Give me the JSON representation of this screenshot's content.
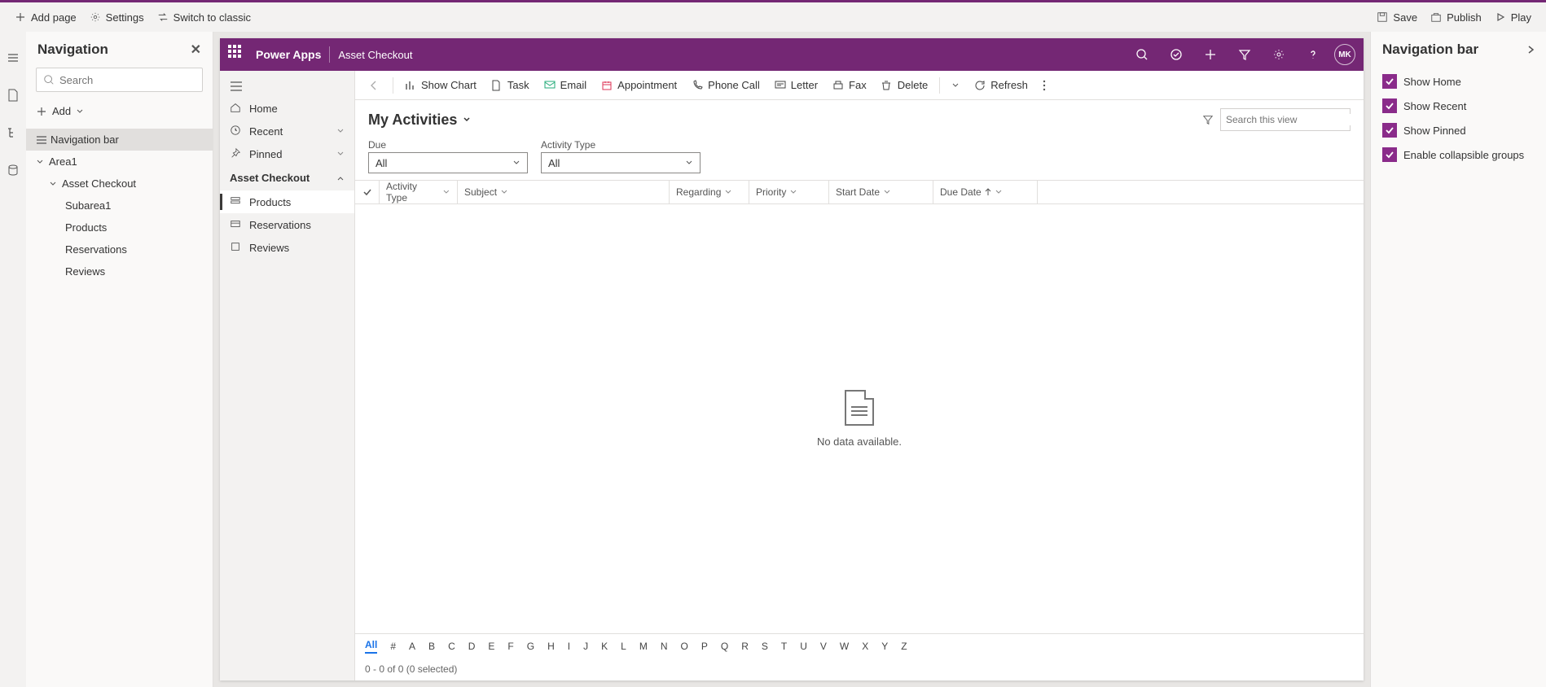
{
  "topbar": {
    "addPage": "Add page",
    "settings": "Settings",
    "switchClassic": "Switch to classic",
    "save": "Save",
    "publish": "Publish",
    "play": "Play"
  },
  "navPanel": {
    "title": "Navigation",
    "searchPlaceholder": "Search",
    "add": "Add",
    "items": {
      "navbar": "Navigation bar",
      "area1": "Area1",
      "assetCheckout": "Asset Checkout",
      "subarea1": "Subarea1",
      "products": "Products",
      "reservations": "Reservations",
      "reviews": "Reviews"
    }
  },
  "purpleBar": {
    "appName": "Power Apps",
    "areaLabel": "Asset Checkout",
    "avatar": "MK"
  },
  "siteNav": {
    "home": "Home",
    "recent": "Recent",
    "pinned": "Pinned",
    "group": "Asset Checkout",
    "products": "Products",
    "reservations": "Reservations",
    "reviews": "Reviews"
  },
  "cmdbar": {
    "showChart": "Show Chart",
    "task": "Task",
    "email": "Email",
    "appointment": "Appointment",
    "phoneCall": "Phone Call",
    "letter": "Letter",
    "fax": "Fax",
    "delete": "Delete",
    "refresh": "Refresh"
  },
  "view": {
    "title": "My Activities",
    "searchPlaceholder": "Search this view",
    "filters": {
      "dueLabel": "Due",
      "dueValue": "All",
      "activityTypeLabel": "Activity Type",
      "activityTypeValue": "All"
    },
    "columns": [
      "Activity Type",
      "Subject",
      "Regarding",
      "Priority",
      "Start Date",
      "Due Date"
    ],
    "empty": "No data available.",
    "index": [
      "All",
      "#",
      "A",
      "B",
      "C",
      "D",
      "E",
      "F",
      "G",
      "H",
      "I",
      "J",
      "K",
      "L",
      "M",
      "N",
      "O",
      "P",
      "Q",
      "R",
      "S",
      "T",
      "U",
      "V",
      "W",
      "X",
      "Y",
      "Z"
    ],
    "status": "0 - 0 of 0 (0 selected)"
  },
  "propsPanel": {
    "title": "Navigation bar",
    "checks": {
      "showHome": "Show Home",
      "showRecent": "Show Recent",
      "showPinned": "Show Pinned",
      "collapsible": "Enable collapsible groups"
    }
  }
}
